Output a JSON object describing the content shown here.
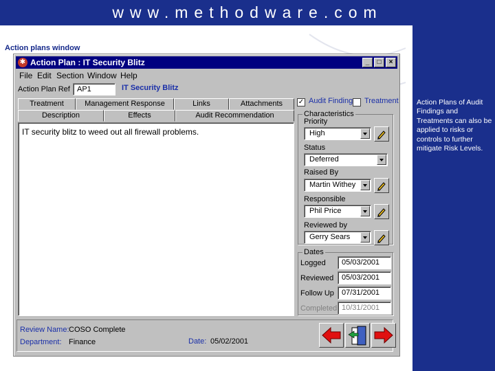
{
  "banner": {
    "url": "www.methodware.com"
  },
  "slide": {
    "title": "Action plans window",
    "caption": "Action Plans of Audit Findings and Treatments can also be applied to risks or controls to further mitigate Risk Levels."
  },
  "window": {
    "title": "Action Plan : IT Security Blitz",
    "controls": {
      "minimize": "_",
      "maximize": "□",
      "close": "×"
    },
    "menu": [
      "File",
      "Edit",
      "Section",
      "Window",
      "Help"
    ]
  },
  "header": {
    "ref_label": "Action Plan Ref",
    "ref_value": "AP1",
    "plan_name": "IT Security Blitz"
  },
  "tabs": {
    "row1": [
      "Treatment",
      "Management Response",
      "Links",
      "Attachments"
    ],
    "row2": [
      "Description",
      "Effects",
      "Audit Recommendation"
    ],
    "active": "Description"
  },
  "description": {
    "text": "IT security blitz to weed out all firewall problems."
  },
  "type_checks": {
    "audit_finding": {
      "label": "Audit Finding",
      "checked": true
    },
    "treatment": {
      "label": "Treatment",
      "checked": false
    }
  },
  "characteristics": {
    "group_label": "Characteristics",
    "priority": {
      "label": "Priority",
      "value": "High"
    },
    "status": {
      "label": "Status",
      "value": "Deferred"
    },
    "raised_by": {
      "label": "Raised By",
      "value": "Martin Withey"
    },
    "responsible": {
      "label": "Responsible",
      "value": "Phil Price"
    },
    "reviewed_by": {
      "label": "Reviewed by",
      "value": "Gerry Sears"
    }
  },
  "dates": {
    "group_label": "Dates",
    "logged": {
      "label": "Logged",
      "value": "05/03/2001"
    },
    "reviewed": {
      "label": "Reviewed",
      "value": "05/03/2001"
    },
    "follow_up": {
      "label": "Follow Up",
      "value": "07/31/2001"
    },
    "completed": {
      "label": "Completed",
      "value": "10/31/2001"
    }
  },
  "footer": {
    "review_name_label": "Review Name:",
    "review_name_value": "COSO Complete",
    "department_label": "Department:",
    "department_value": "Finance",
    "date_label": "Date:",
    "date_value": "05/02/2001"
  },
  "colors": {
    "banner": "#1a2f8c",
    "titlebar": "#000080",
    "label_blue": "#1a2fa8",
    "arrow_red": "#e01010"
  },
  "icons": [
    "app-icon",
    "combo-arrow-icon",
    "pencil-icon",
    "back-arrow-icon",
    "exit-door-icon",
    "forward-arrow-icon",
    "checkmark-icon"
  ]
}
